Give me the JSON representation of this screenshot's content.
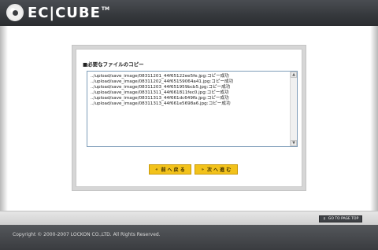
{
  "header": {
    "logo_text": "EC|CUBE",
    "logo_tm": "TM"
  },
  "panel": {
    "section_title": "■必要なファイルのコピー",
    "log_lines": [
      "../upload/save_image/08311201_44f65122ee5fe.jpg:コピー成功",
      "../upload/save_image/08311202_44f65159064a41.jpg:コピー成功",
      "../upload/save_image/08311203_44f651959bcb5.jpg:コピー成功",
      "../upload/save_image/08311311_44f661811fec0.jpg:コピー成功",
      "../upload/save_image/08311313_44f661dc649fb.jpg:コピー成功",
      "../upload/save_image/08311313_44f661e5698a6.jpg:コピー成功"
    ],
    "scroll_up_glyph": "▲",
    "scroll_down_glyph": "▼"
  },
  "buttons": {
    "prev_arrow": "«",
    "prev_label": "前 へ 戻 る",
    "next_arrow": "»",
    "next_label": "次 へ 進 む"
  },
  "pagetop": {
    "arrow": "↑",
    "label": "GO TO PAGE TOP"
  },
  "footer": {
    "copyright": "Copyright © 2000-2007 LOCKON CO.,LTD. All Rights Reserved."
  }
}
